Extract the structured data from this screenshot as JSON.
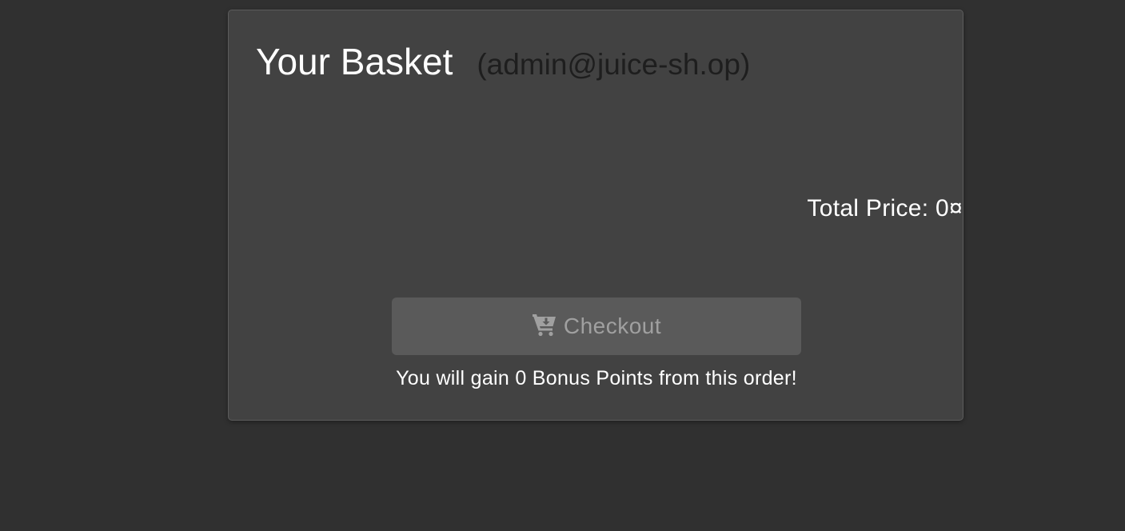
{
  "basket": {
    "title": "Your Basket",
    "user": "(admin@juice-sh.op)",
    "total_price_label": "Total Price: 0¤",
    "checkout": {
      "label": "Checkout",
      "icon": "cart-arrow-down-icon",
      "enabled": false
    },
    "bonus_text": "You will gain 0 Bonus Points from this order!"
  },
  "colors": {
    "background": "#303030",
    "card": "#424242",
    "button_disabled": "#5a5a5a",
    "button_text_disabled": "#a0a0a0",
    "user_email": "#1e1e1e"
  }
}
